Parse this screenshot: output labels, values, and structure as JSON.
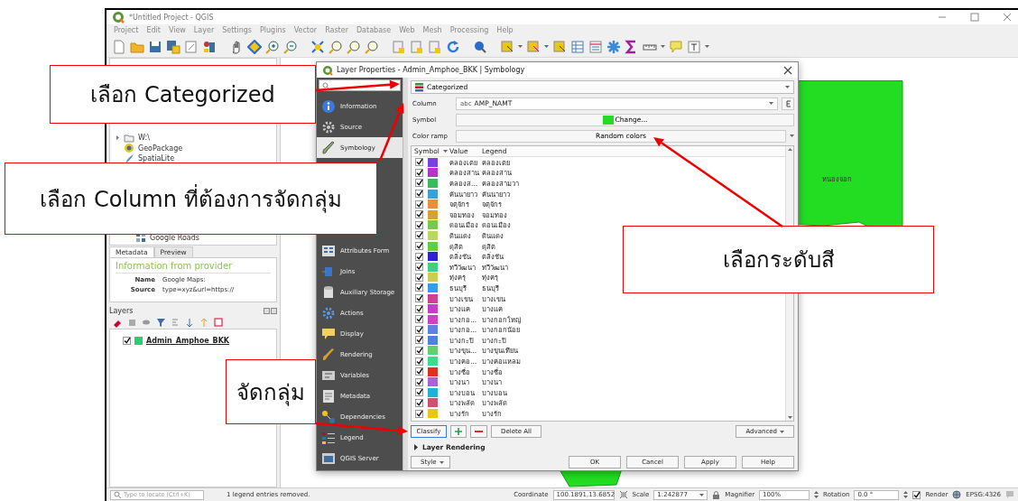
{
  "window": {
    "title": "*Untitled Project - QGIS"
  },
  "menu": [
    "Project",
    "Edit",
    "View",
    "Layer",
    "Settings",
    "Plugins",
    "Vector",
    "Raster",
    "Database",
    "Web",
    "Mesh",
    "Processing",
    "Help"
  ],
  "browser": {
    "items": [
      "W:\\",
      "GeoPackage",
      "SpatiaLite"
    ],
    "bottom_item": "Google Roads"
  },
  "metadata_panel": {
    "tabs": [
      {
        "label": "Metadata",
        "selected": true
      },
      {
        "label": "Preview",
        "selected": false
      }
    ],
    "heading": "Information from provider",
    "fields": [
      {
        "name": "Name",
        "value": "Google Maps:"
      },
      {
        "name": "Source",
        "value": "type=xyz&url=https://"
      }
    ]
  },
  "layers_panel": {
    "title": "Layers",
    "layers": [
      {
        "name": "Admin_Amphoe_BKK",
        "checked": true
      }
    ]
  },
  "map": {
    "label": "หนองจอก"
  },
  "dialog": {
    "title": "Layer Properties - Admin_Amphoe_BKK | Symbology",
    "sidebar": [
      {
        "label": "Information",
        "selected": false
      },
      {
        "label": "Source",
        "selected": false
      },
      {
        "label": "Symbology",
        "selected": true
      },
      {
        "label": "Attributes Form",
        "selected": false
      },
      {
        "label": "Joins",
        "selected": false
      },
      {
        "label": "Auxiliary Storage",
        "selected": false
      },
      {
        "label": "Actions",
        "selected": false
      },
      {
        "label": "Display",
        "selected": false
      },
      {
        "label": "Rendering",
        "selected": false
      },
      {
        "label": "Variables",
        "selected": false
      },
      {
        "label": "Metadata",
        "selected": false
      },
      {
        "label": "Dependencies",
        "selected": false
      },
      {
        "label": "Legend",
        "selected": false
      },
      {
        "label": "QGIS Server",
        "selected": false
      }
    ],
    "renderer": "Categorized",
    "column": {
      "label": "Column",
      "type_tag": "abc",
      "value": "AMP_NAMT"
    },
    "symbol": {
      "label": "Symbol",
      "button": "Change..."
    },
    "color_ramp": {
      "label": "Color ramp",
      "value": "Random colors"
    },
    "table": {
      "columns": [
        "Symbol",
        "Value",
        "Legend"
      ],
      "rows": [
        {
          "checked": true,
          "color": "#7b3fe0",
          "value": "คลองเตย",
          "legend": "คลองเตย"
        },
        {
          "checked": true,
          "color": "#c030c8",
          "value": "คลองสาน",
          "legend": "คลองสาน"
        },
        {
          "checked": true,
          "color": "#3cb860",
          "value": "คลองส...",
          "legend": "คลองสามวา"
        },
        {
          "checked": true,
          "color": "#3aa0d8",
          "value": "คันนายาว",
          "legend": "คันนายาว"
        },
        {
          "checked": true,
          "color": "#e8903a",
          "value": "จตุจักร",
          "legend": "จตุจักร"
        },
        {
          "checked": true,
          "color": "#d8a030",
          "value": "จอมทอง",
          "legend": "จอมทอง"
        },
        {
          "checked": true,
          "color": "#78c850",
          "value": "ดอนเมือง",
          "legend": "ดอนเมือง"
        },
        {
          "checked": true,
          "color": "#b8d860",
          "value": "ดินแดง",
          "legend": "ดินแดง"
        },
        {
          "checked": true,
          "color": "#60d040",
          "value": "ดุสิต",
          "legend": "ดุสิต"
        },
        {
          "checked": true,
          "color": "#3020d0",
          "value": "ตลิ่งชัน",
          "legend": "ตลิ่งชัน"
        },
        {
          "checked": true,
          "color": "#40d080",
          "value": "ทวีวัฒนา",
          "legend": "ทวีวัฒนา"
        },
        {
          "checked": true,
          "color": "#c8d050",
          "value": "ทุ่งครุ",
          "legend": "ทุ่งครุ"
        },
        {
          "checked": true,
          "color": "#30a0e8",
          "value": "ธนบุรี",
          "legend": "ธนบุรี"
        },
        {
          "checked": true,
          "color": "#d04090",
          "value": "บางเขน",
          "legend": "บางเขน"
        },
        {
          "checked": true,
          "color": "#c040c8",
          "value": "บางแค",
          "legend": "บางแค"
        },
        {
          "checked": true,
          "color": "#d040c0",
          "value": "บางกอ...",
          "legend": "บางกอกใหญ่"
        },
        {
          "checked": true,
          "color": "#6080e8",
          "value": "บางกอ...",
          "legend": "บางกอกน้อย"
        },
        {
          "checked": true,
          "color": "#5080e0",
          "value": "บางกะปิ",
          "legend": "บางกะปิ"
        },
        {
          "checked": true,
          "color": "#60d070",
          "value": "บางขุน...",
          "legend": "บางขุนเทียน"
        },
        {
          "checked": true,
          "color": "#40d890",
          "value": "บางคอ...",
          "legend": "บางคอแหลม"
        },
        {
          "checked": true,
          "color": "#e03020",
          "value": "บางซื่อ",
          "legend": "บางซื่อ"
        },
        {
          "checked": true,
          "color": "#b060d0",
          "value": "บางนา",
          "legend": "บางนา"
        },
        {
          "checked": true,
          "color": "#20b0d8",
          "value": "บางบอน",
          "legend": "บางบอน"
        },
        {
          "checked": true,
          "color": "#d05070",
          "value": "บางพลัด",
          "legend": "บางพลัด"
        },
        {
          "checked": true,
          "color": "#e8c800",
          "value": "บางรัก",
          "legend": "บางรัก"
        }
      ]
    },
    "classify_button": "Classify",
    "delete_all_button": "Delete All",
    "advanced_button": "Advanced",
    "layer_rendering": {
      "label": "Layer Rendering",
      "expanded": false
    },
    "style_button": "Style",
    "footer_buttons": [
      "OK",
      "Cancel",
      "Apply",
      "Help"
    ]
  },
  "status_bar": {
    "search_placeholder": "Type to locate (Ctrl+K)",
    "message": "1 legend entries removed.",
    "coordinate_label": "Coordinate",
    "coordinate": "100.1891,13.6852",
    "scale_label": "Scale",
    "scale": "1:242877",
    "magnifier_label": "Magnifier",
    "magnifier": "100%",
    "rotation_label": "Rotation",
    "rotation": "0.0 °",
    "render": {
      "label": "Render",
      "checked": true
    },
    "crs": "EPSG:4326"
  },
  "callouts": [
    {
      "text": "เลือก Categorized"
    },
    {
      "text": "เลือก Column ที่ต้องการจัดกลุ่ม"
    },
    {
      "text": "เลือกระดับสี"
    },
    {
      "text": "จัดกลุ่ม"
    }
  ]
}
